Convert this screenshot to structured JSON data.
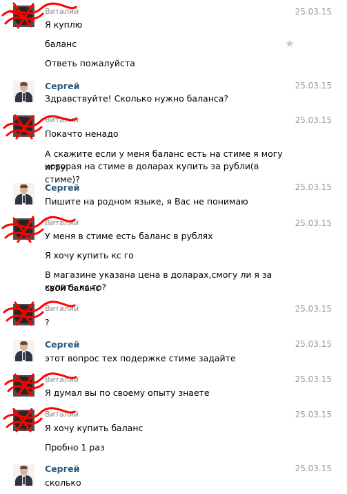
{
  "messages": [
    {
      "author": "Виталий",
      "date": "25.03.15",
      "lines": [
        "Я куплю",
        "баланс",
        "Ответь пожалуйста"
      ]
    },
    {
      "author": "Сергей",
      "date": "25.03.15",
      "lines": [
        "Здравствуйте! Сколько нужно баланса?"
      ]
    },
    {
      "author": "Виталий",
      "date": "25.03.15",
      "lines": [
        "Покачто ненадо",
        "А скажите если у меня баланс есть на стиме я могу игру",
        "которая на стиме в доларах купить за рубли(в стиме)?"
      ]
    },
    {
      "author": "Сергей",
      "date": "25.03.15",
      "lines": [
        "Пишите на родном языке, я Вас не понимаю"
      ]
    },
    {
      "author": "Виталий",
      "date": "25.03.15",
      "lines": [
        "У меня в стиме есть баланс в рублях",
        "Я хочу купить кс го",
        "В магазине указана цена в доларах,смогу ли я за свой баланс",
        "купить кс го?"
      ]
    },
    {
      "author": "Виталий",
      "date": "25.03.15",
      "lines": [
        "?"
      ]
    },
    {
      "author": "Сергей",
      "date": "25.03.15",
      "lines": [
        "этот вопрос тех подержке стиме задайте"
      ]
    },
    {
      "author": "Виталий",
      "date": "25.03.15",
      "lines": [
        "Я думал вы по своему опыту знаете"
      ]
    },
    {
      "author": "Виталий",
      "date": "25.03.15",
      "lines": [
        "Я хочу купить баланс",
        "Пробно 1 раз"
      ]
    },
    {
      "author": "Сергей",
      "date": "25.03.15",
      "lines": [
        "сколько"
      ]
    }
  ],
  "colors": {
    "author_link": "#2b587a",
    "date": "#999999",
    "redaction": "#ff0000"
  },
  "icons": {
    "favorite": "star-icon"
  }
}
